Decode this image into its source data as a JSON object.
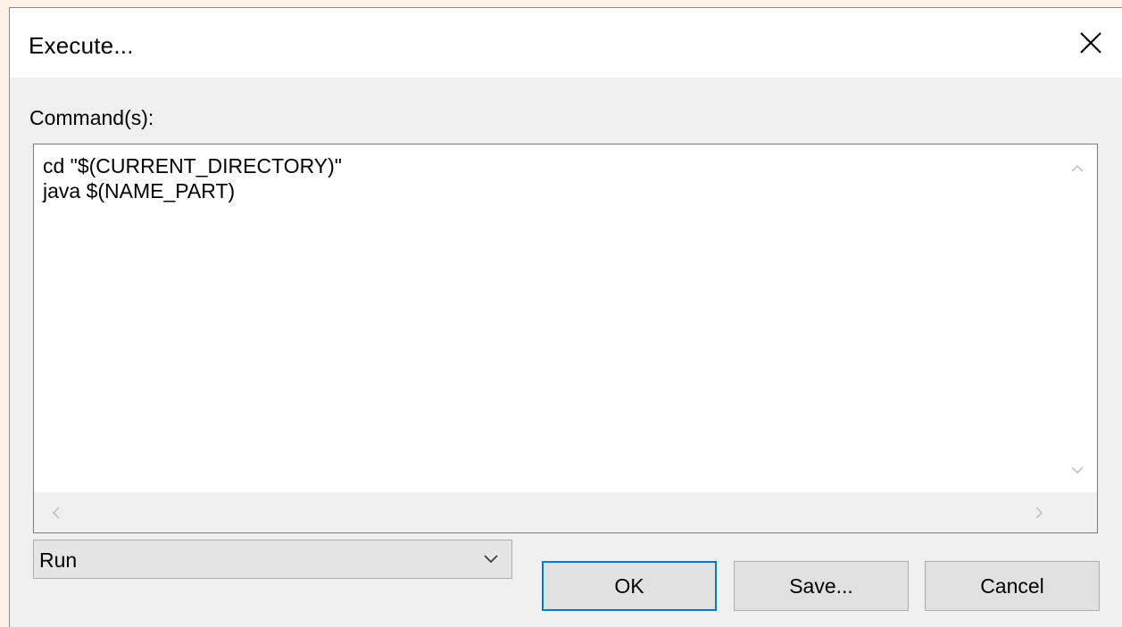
{
  "dialog": {
    "title": "Execute...",
    "close_icon": "close-icon"
  },
  "commands": {
    "label": "Command(s):",
    "lines": [
      "cd \"$(CURRENT_DIRECTORY)\"",
      "java $(NAME_PART)"
    ]
  },
  "mode_select": {
    "value": "Run"
  },
  "buttons": {
    "ok": "OK",
    "save": "Save...",
    "cancel": "Cancel"
  },
  "colors": {
    "accent": "#0078d7",
    "dialog_bg": "#f0f0f0",
    "titlebar_bg": "#ffffff",
    "outer_bg": "#fcf3e6"
  }
}
